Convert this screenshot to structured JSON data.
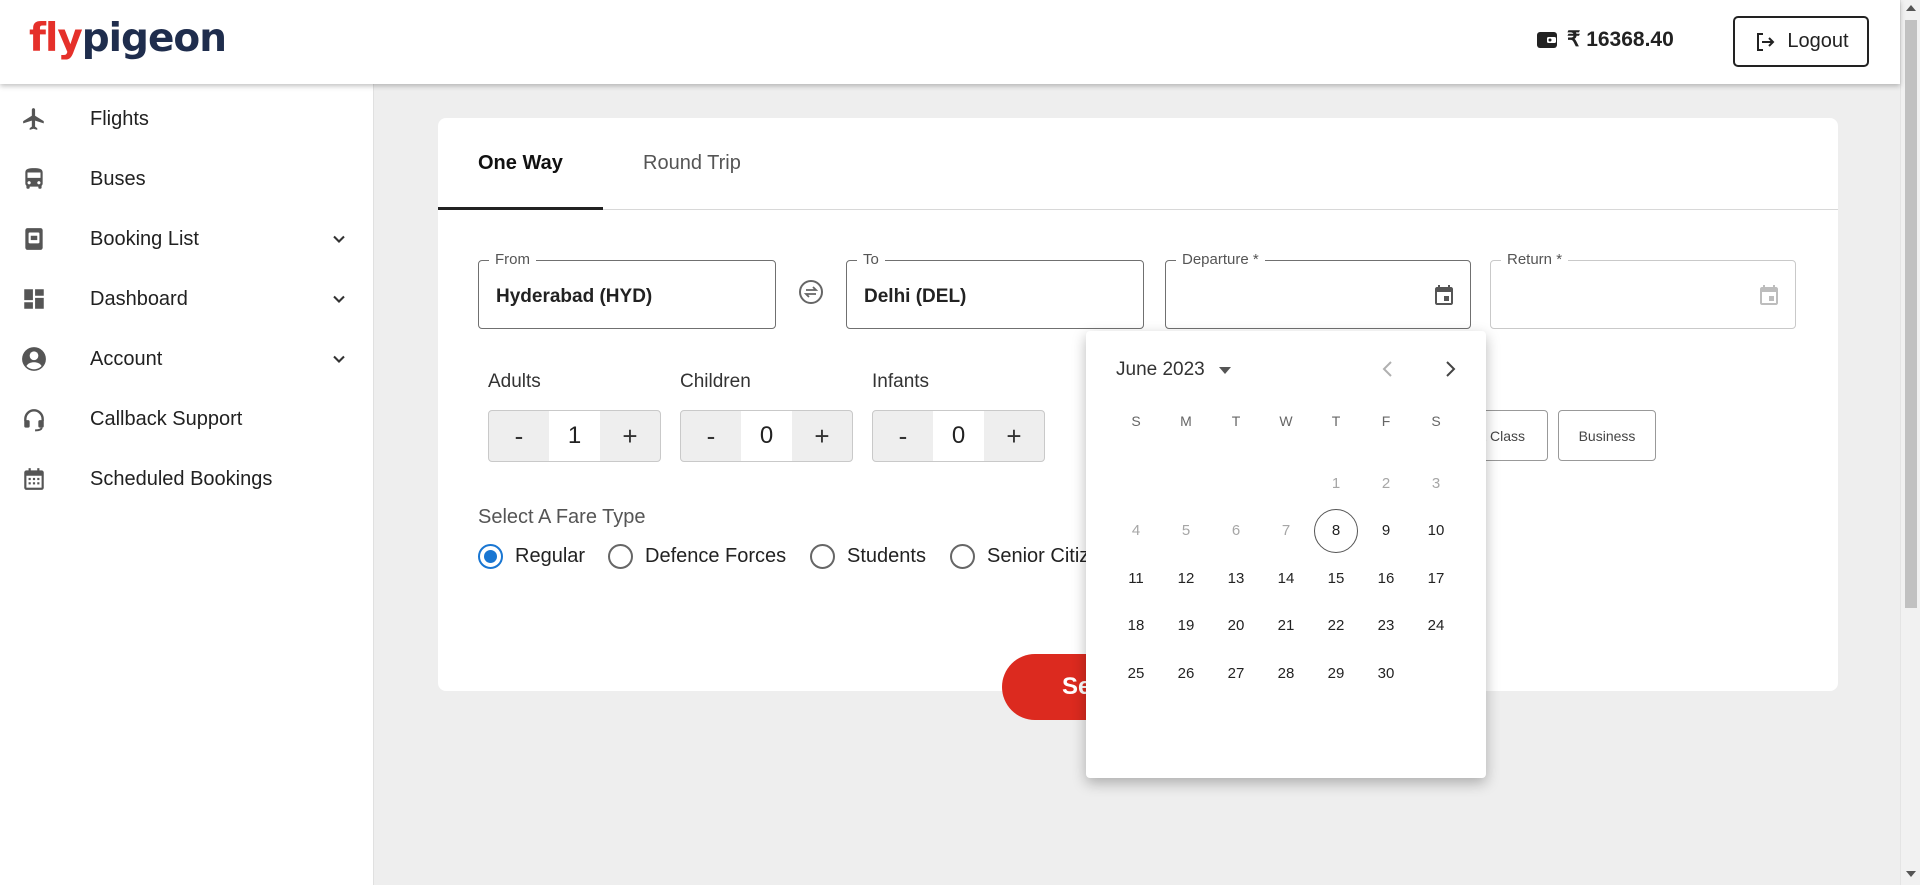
{
  "brand": {
    "part1": "fly",
    "part2": "pigeon"
  },
  "header": {
    "wallet_balance": "₹ 16368.40",
    "logout_label": "Logout"
  },
  "sidebar": {
    "items": [
      {
        "label": "Flights",
        "icon": "airplane-icon",
        "expandable": false
      },
      {
        "label": "Buses",
        "icon": "bus-icon",
        "expandable": false
      },
      {
        "label": "Booking List",
        "icon": "booking-list-icon",
        "expandable": true
      },
      {
        "label": "Dashboard",
        "icon": "dashboard-icon",
        "expandable": true
      },
      {
        "label": "Account",
        "icon": "account-icon",
        "expandable": true
      },
      {
        "label": "Callback Support",
        "icon": "headset-icon",
        "expandable": false
      },
      {
        "label": "Scheduled Bookings",
        "icon": "calendar-icon",
        "expandable": false
      }
    ]
  },
  "tabs": {
    "one_way": "One Way",
    "round_trip": "Round Trip",
    "active": "One Way"
  },
  "fields": {
    "from": {
      "label": "From",
      "value": "Hyderabad (HYD)"
    },
    "to": {
      "label": "To",
      "value": "Delhi (DEL)"
    },
    "departure": {
      "label": "Departure *",
      "value": ""
    },
    "return": {
      "label": "Return *",
      "value": ""
    }
  },
  "passengers": {
    "adults": {
      "label": "Adults",
      "value": "1"
    },
    "children": {
      "label": "Children",
      "value": "0"
    },
    "infants": {
      "label": "Infants",
      "value": "0"
    },
    "minus": "-",
    "plus": "+"
  },
  "cabin_class": {
    "partial_visible": "t Class",
    "business": "Business"
  },
  "fare_type": {
    "title": "Select A Fare Type",
    "options": [
      "Regular",
      "Defence Forces",
      "Students",
      "Senior Citiz"
    ],
    "selected": "Regular"
  },
  "search": {
    "label_visible": "Se"
  },
  "datepicker": {
    "month_label": "June 2023",
    "weekdays": [
      "S",
      "M",
      "T",
      "W",
      "T",
      "F",
      "S"
    ],
    "first_weekday_index": 4,
    "days_in_month": 30,
    "today": 8,
    "disabled_before": 8,
    "accent": "#1976d2"
  },
  "colors": {
    "brand_red": "#e5302a",
    "brand_navy": "#1f2d4d",
    "search_red": "#dc2a1f"
  }
}
